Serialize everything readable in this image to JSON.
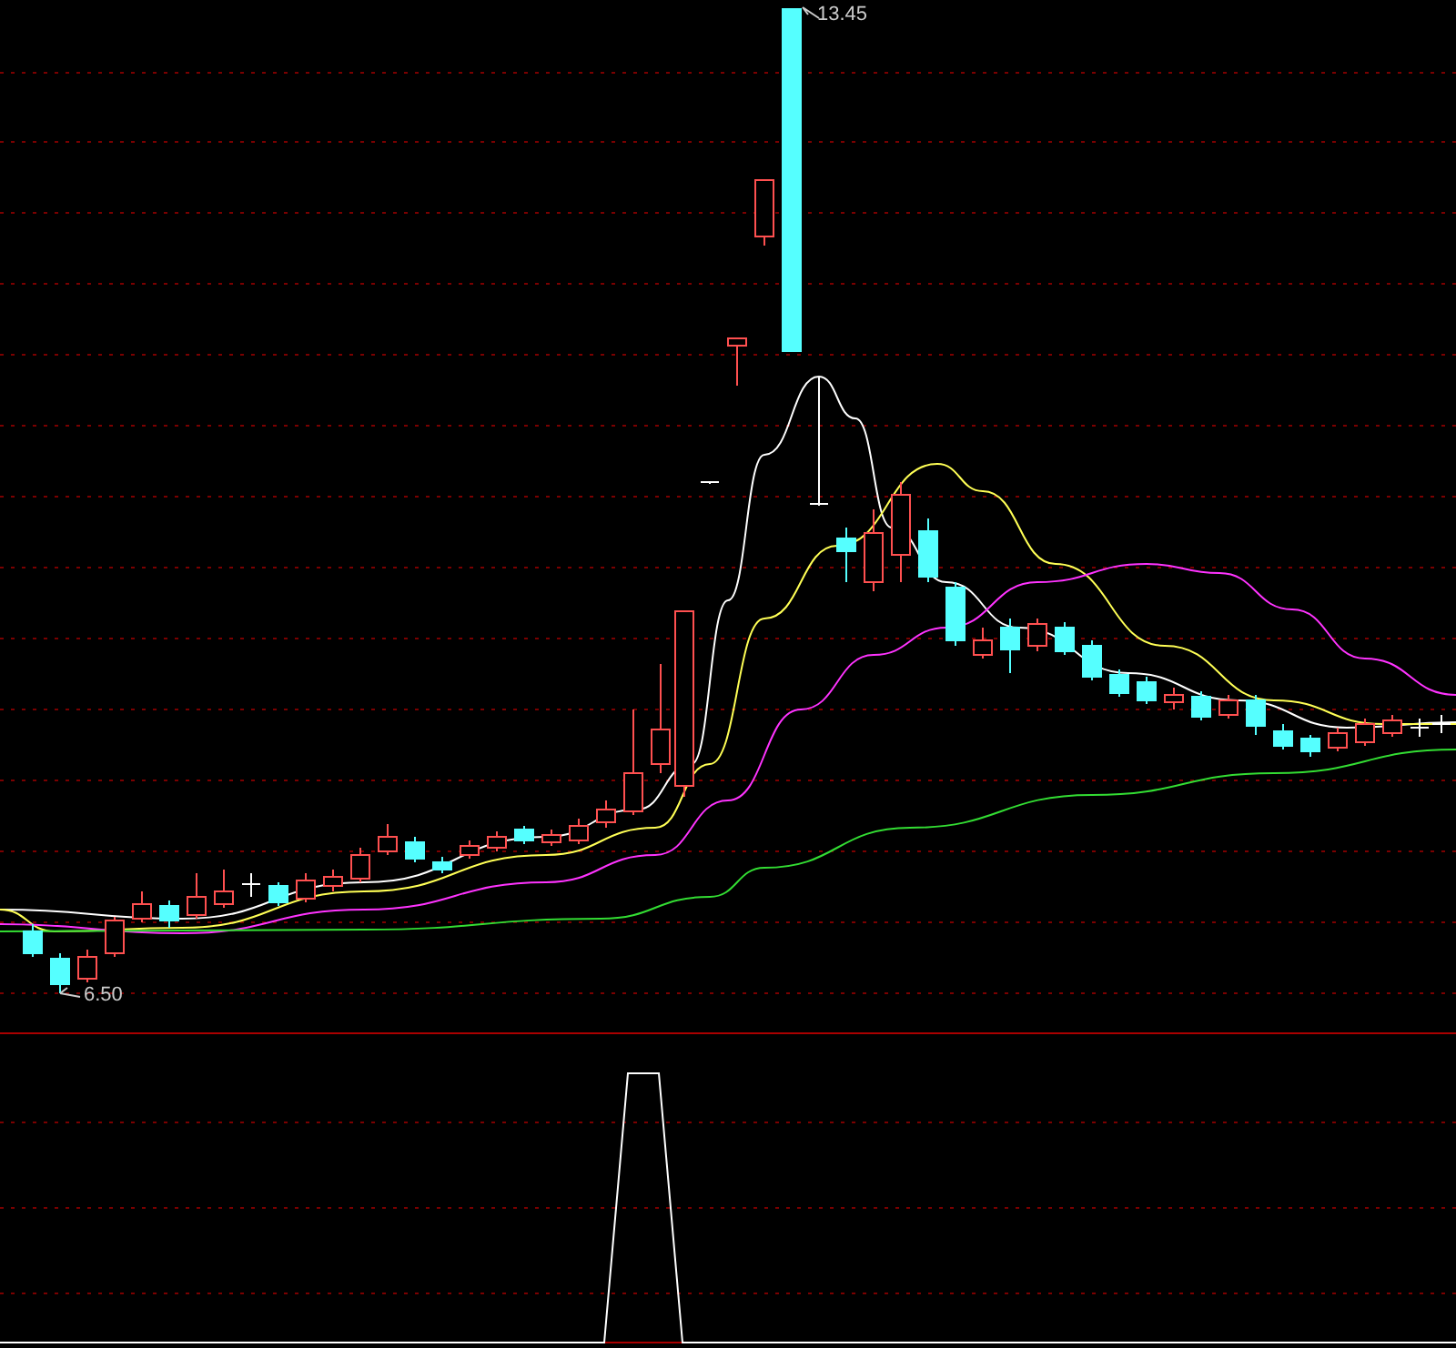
{
  "price_chart": {
    "high_label": "13.45",
    "low_label": "6.50"
  }
}
